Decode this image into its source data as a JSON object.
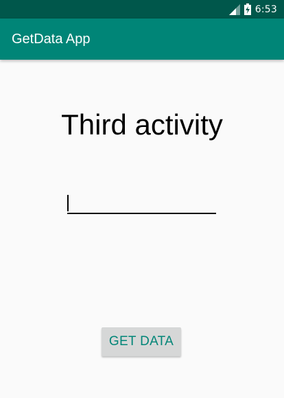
{
  "status_bar": {
    "time": "6:53",
    "signal_icon": "cellular-signal-icon",
    "battery_icon": "battery-charging-icon"
  },
  "app_bar": {
    "title": "GetData App"
  },
  "main": {
    "title": "Third activity",
    "input": {
      "value": "",
      "placeholder": ""
    },
    "button_label": "GET DATA"
  },
  "colors": {
    "status_bar": "#00574b",
    "primary": "#008577",
    "background": "#fafafa",
    "button_background": "#d6d7d7"
  }
}
